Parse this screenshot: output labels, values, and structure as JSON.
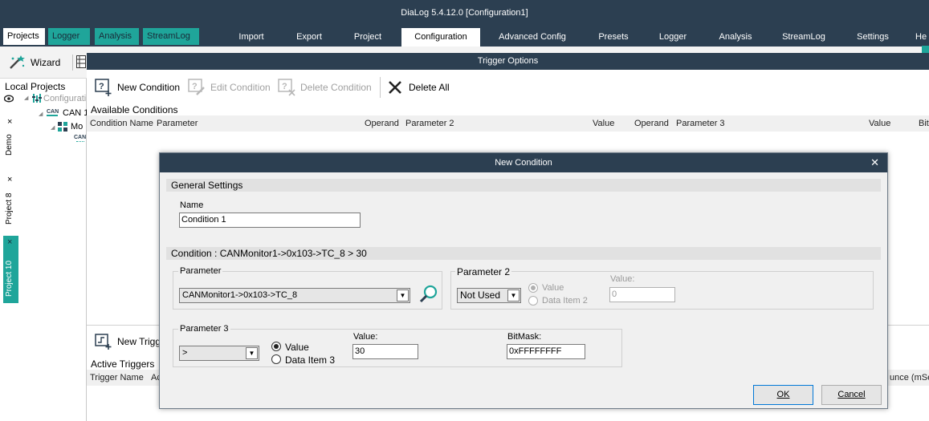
{
  "window": {
    "title": "DiaLog 5.4.12.0    [Configuration1]"
  },
  "left_tabs": [
    {
      "label": "Projects"
    },
    {
      "label": "Logger"
    },
    {
      "label": "Analysis"
    },
    {
      "label": "StreamLog"
    }
  ],
  "menu": [
    {
      "label": "Import"
    },
    {
      "label": "Export"
    },
    {
      "label": "Project"
    },
    {
      "label": "Configuration"
    },
    {
      "label": "Advanced Config"
    },
    {
      "label": "Presets"
    },
    {
      "label": "Logger"
    },
    {
      "label": "Analysis"
    },
    {
      "label": "StreamLog"
    },
    {
      "label": "Settings"
    },
    {
      "label": "He"
    }
  ],
  "toolbar": {
    "wizard_label": "Wizard"
  },
  "projects_pane": {
    "title": "Local Projects",
    "tree": [
      {
        "label": "Configurati"
      },
      {
        "label": "CAN 1"
      },
      {
        "label": "Mo"
      },
      {
        "label": "CAN"
      }
    ],
    "vertical_tabs": [
      {
        "label": "Demo",
        "close": "×"
      },
      {
        "label": "Project 8",
        "close": "×"
      },
      {
        "label": "Project 10",
        "close": "×"
      }
    ]
  },
  "trigger_options": {
    "title": "Trigger Options",
    "buttons": {
      "new_condition": "New Condition",
      "edit_condition": "Edit Condition",
      "delete_condition": "Delete Condition",
      "delete_all": "Delete All"
    },
    "available_conditions_label": "Available Conditions",
    "condition_columns": [
      "Condition Name",
      "Parameter",
      "Operand",
      "Parameter 2",
      "Value",
      "Operand",
      "Parameter 3",
      "Value",
      "Bit"
    ],
    "new_trigger_label": "New Trigg",
    "active_triggers_label": "Active Triggers",
    "trigger_columns": [
      "Trigger Name",
      "Ac",
      "unce (mSe"
    ]
  },
  "dialog": {
    "title": "New Condition",
    "close_glyph": "✕",
    "general_settings": "General Settings",
    "name_label": "Name",
    "name_value": "Condition 1",
    "condition_summary": "Condition : CANMonitor1->0x103->TC_8 > 30",
    "parameter": {
      "label": "Parameter",
      "value": "CANMonitor1->0x103->TC_8"
    },
    "parameter2": {
      "label": "Parameter 2",
      "combo_value": "Not Used",
      "radio_value": "Value",
      "radio_item": "Data Item 2",
      "value_label": "Value:",
      "value": "0"
    },
    "parameter3": {
      "label": "Parameter 3",
      "operand": ">",
      "radio_value": "Value",
      "radio_item": "Data Item 3",
      "value_label": "Value:",
      "value": "30",
      "bitmask_label": "BitMask:",
      "bitmask_value": "0xFFFFFFFF"
    },
    "ok_label": "OK",
    "cancel_label": "Cancel"
  },
  "colors": {
    "titlebar": "#2c3f51",
    "tab_accent": "#1fa59a",
    "dialog_bg": "#f0f0f0"
  }
}
